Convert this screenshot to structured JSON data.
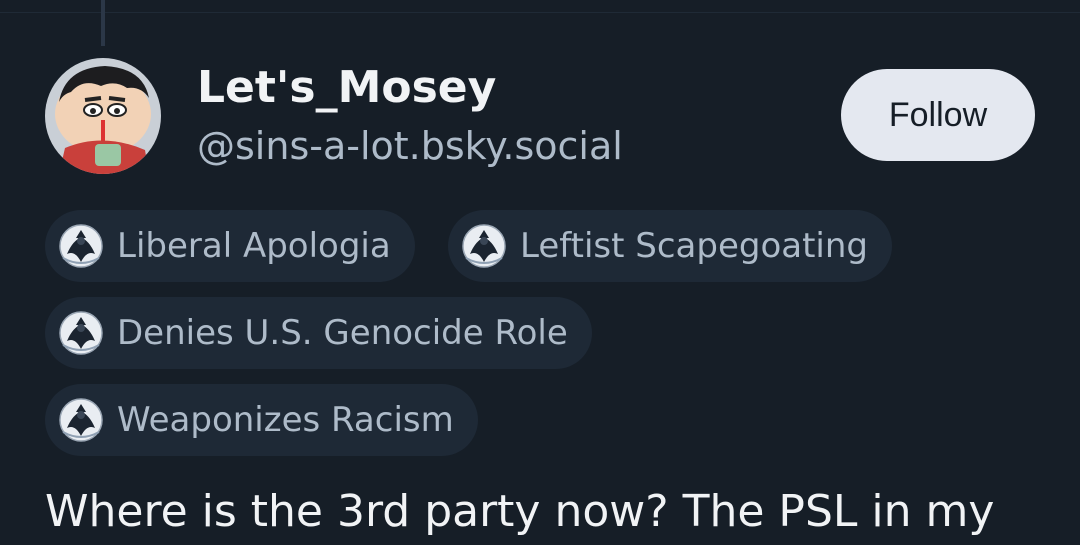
{
  "author": {
    "display_name": "Let's_Mosey",
    "handle": "@sins-a-lot.bsky.social"
  },
  "follow_button": {
    "label": "Follow"
  },
  "labels": [
    {
      "text": "Liberal Apologia",
      "icon": "labeler-avatar-icon"
    },
    {
      "text": "Leftist Scapegoating",
      "icon": "labeler-avatar-icon"
    },
    {
      "text": "Denies U.S. Genocide Role",
      "icon": "labeler-avatar-icon"
    },
    {
      "text": "Weaponizes Racism",
      "icon": "labeler-avatar-icon"
    }
  ],
  "post": {
    "text": "Where is the 3rd party now? The PSL in my"
  },
  "colors": {
    "background": "#161e27",
    "pill_background": "#1e2936",
    "muted_text": "#aebbc9",
    "primary_text": "#f1f3f5",
    "follow_button_bg": "#e4e8f0"
  }
}
